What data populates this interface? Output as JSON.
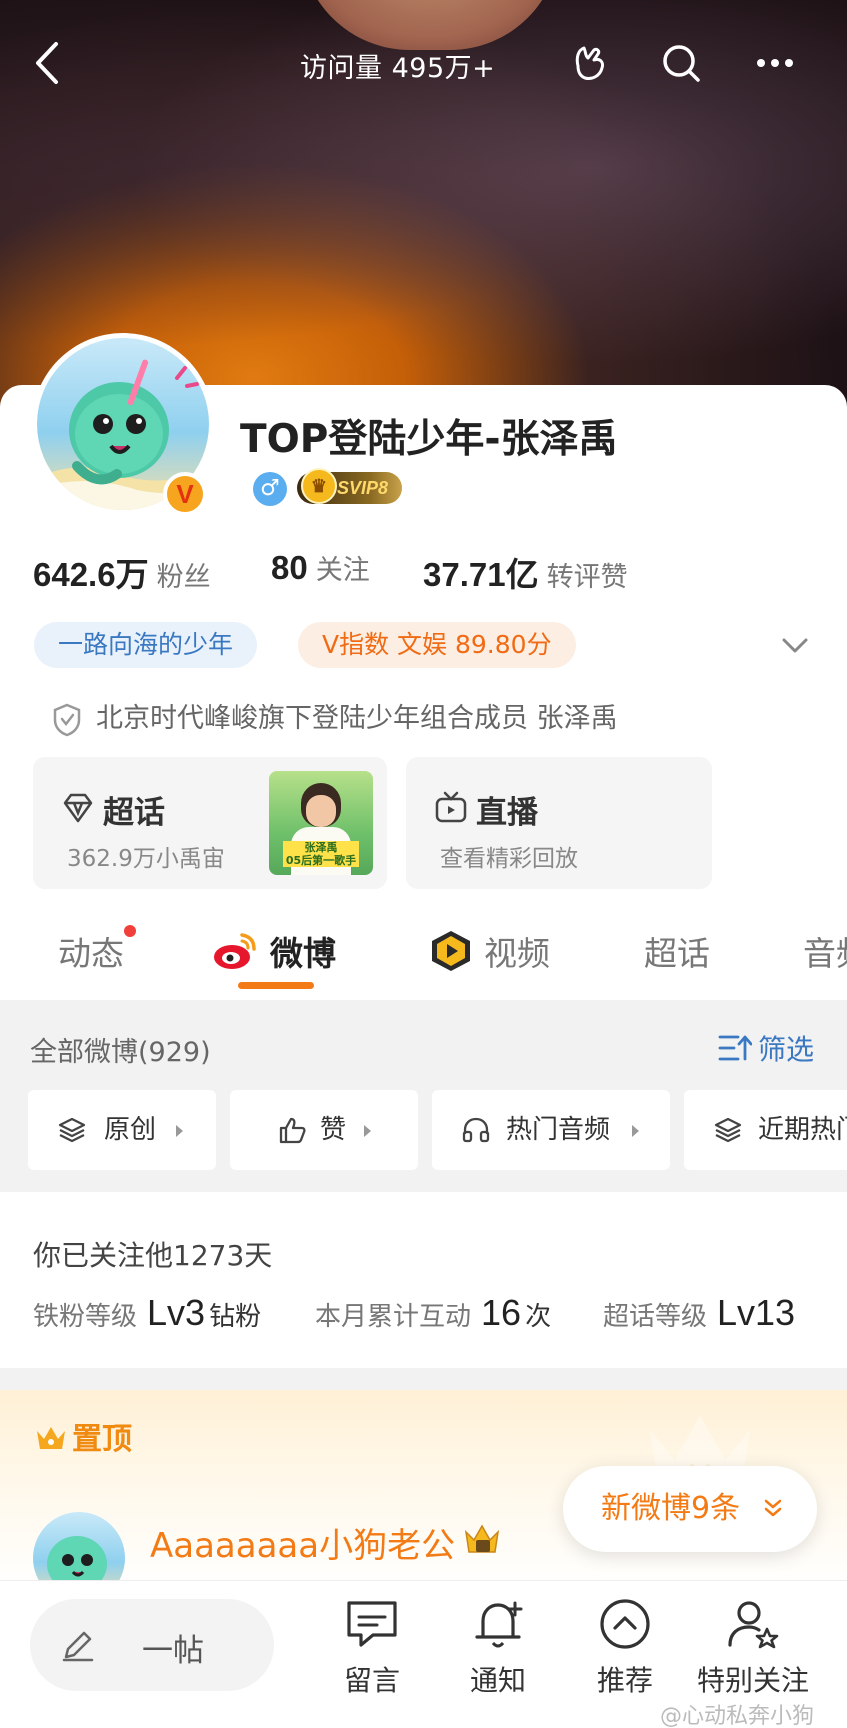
{
  "topbar": {
    "visits": "访问量 495万+",
    "icons": [
      "back-icon",
      "hand-wave-icon",
      "search-icon",
      "more-icon"
    ]
  },
  "profile": {
    "name": "TOP登陆少年-张泽禹",
    "gender_symbol": "♂",
    "vip_label": "SVIP8",
    "verified_mark": "V",
    "stats": [
      {
        "value": "642.6万",
        "label": "粉丝"
      },
      {
        "value": "80",
        "label": "关注"
      },
      {
        "value": "37.71亿",
        "label": "转评赞"
      }
    ],
    "tags": [
      "一路向海的少年",
      "V指数 文娱 89.80分"
    ],
    "verification": "北京时代峰峻旗下登陆少年组合成员 张泽禹"
  },
  "entries": {
    "supertopic": {
      "title": "超话",
      "sub": "362.9万小禹宙",
      "thumb_name": "张泽禹",
      "thumb_caption": "05后第一歌手"
    },
    "live": {
      "title": "直播",
      "sub": "查看精彩回放"
    }
  },
  "tabs": [
    {
      "label": "动态",
      "dot": true
    },
    {
      "label": "微博",
      "active": true
    },
    {
      "label": "视频"
    },
    {
      "label": "超话"
    },
    {
      "label": "音频"
    }
  ],
  "feed": {
    "all_label": "全部微博(929)",
    "filter_label": "筛选",
    "chips": [
      "原创",
      "赞",
      "热门音频",
      "近期热门"
    ]
  },
  "follow": {
    "days": "你已关注他1273天",
    "fan_level_label": "铁粉等级",
    "fan_level_value": "Lv3",
    "fan_level_unit": "钻粉",
    "interact_label": "本月累计互动",
    "interact_value": "16",
    "interact_unit": "次",
    "topic_level_label": "超话等级",
    "topic_level_value": "Lv13"
  },
  "pinned": {
    "label": "置顶",
    "author": "Aaaaaaaa小狗老公",
    "new_posts": "新微博9条"
  },
  "bottom": {
    "post_label": "一帖",
    "items": [
      "留言",
      "通知",
      "推荐",
      "特别关注"
    ]
  },
  "watermark": "@心动私奔小狗",
  "colors": {
    "accent": "#f37b16",
    "link": "#3a78c2",
    "badge": "#f7a51e"
  }
}
